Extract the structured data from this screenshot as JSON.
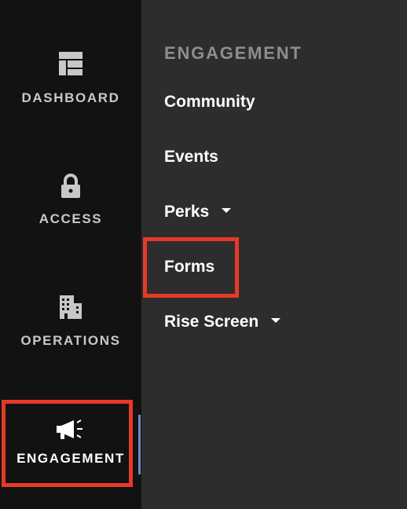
{
  "rail": {
    "items": [
      {
        "label": "DASHBOARD",
        "icon": "dashboard-icon"
      },
      {
        "label": "ACCESS",
        "icon": "lock-icon"
      },
      {
        "label": "OPERATIONS",
        "icon": "building-icon"
      },
      {
        "label": "ENGAGEMENT",
        "icon": "megaphone-icon",
        "active": true
      }
    ]
  },
  "panel": {
    "title": "ENGAGEMENT",
    "items": [
      {
        "label": "Community"
      },
      {
        "label": "Events"
      },
      {
        "label": "Perks",
        "has_dropdown": true
      },
      {
        "label": "Forms",
        "highlighted": true
      },
      {
        "label": "Rise Screen",
        "has_dropdown": true
      }
    ]
  },
  "colors": {
    "rail_bg": "#121212",
    "panel_bg": "#2d2d2d",
    "highlight": "#e53a26",
    "active_indicator": "#6f86c9"
  }
}
